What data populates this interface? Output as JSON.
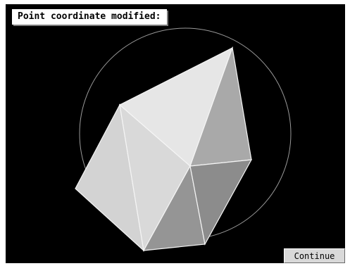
{
  "message": {
    "text": "Point coordinate modified:"
  },
  "buttons": {
    "continue_label": "Continue"
  },
  "colors": {
    "background": "#000000",
    "circle": "#9a9a9a",
    "face_light": "#e6e6e6",
    "face_mid": "#cfcfcf",
    "face_dark": "#a8a8a8",
    "face_darker": "#8f8f8f",
    "edge": "#f5f5f5"
  }
}
